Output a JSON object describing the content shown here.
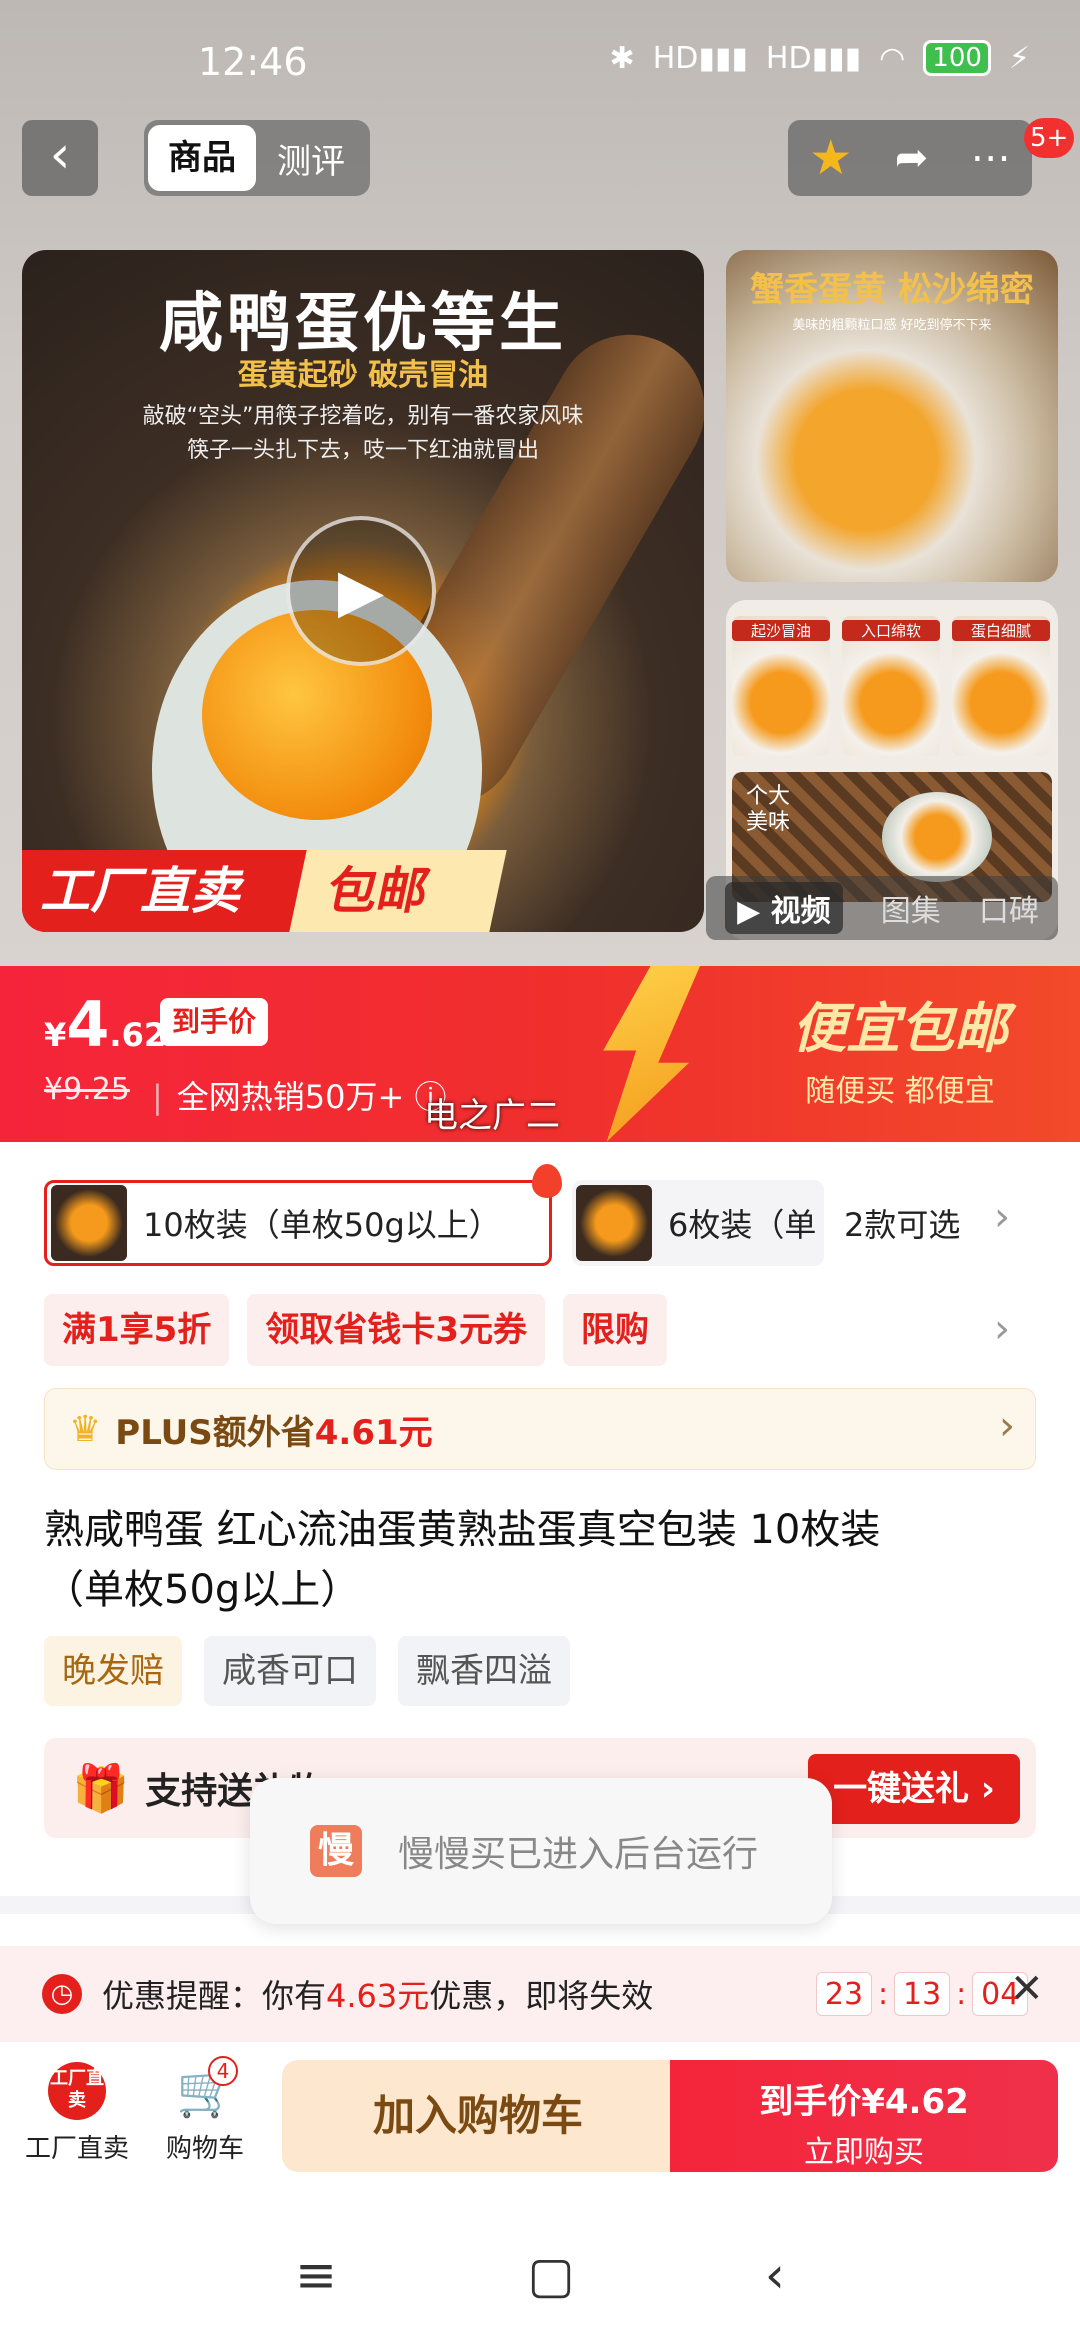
{
  "status_bar": {
    "time": "12:46",
    "network": "HD",
    "battery": "100"
  },
  "nav": {
    "back_icon": "back-icon",
    "tabs": [
      {
        "label": "商品",
        "active": true
      },
      {
        "label": "测评",
        "active": false
      }
    ],
    "message_badge": "5+"
  },
  "gallery": {
    "main": {
      "title": "咸鸭蛋优等生",
      "subtitle": "蛋黄起砂 破壳冒油",
      "desc_line1": "敲破“空头”用筷子挖着吃，别有一番农家风味",
      "desc_line2": "筷子一头扎下去，吱一下红油就冒出",
      "promo_left": "工厂直卖",
      "promo_right": "包邮"
    },
    "thumb1": {
      "caption": "蟹香蛋黄 松沙绵密",
      "caption_small": "美味的粗颗粒口感 好吃到停不下来"
    },
    "thumb2": {
      "labels": [
        "起沙冒油",
        "入口绵软",
        "蛋白细腻"
      ],
      "basket_label_1": "个大",
      "basket_label_2": "美味"
    },
    "media_tabs": [
      {
        "label": "视频",
        "active": true
      },
      {
        "label": "图集",
        "active": false
      },
      {
        "label": "口碑",
        "active": false
      }
    ]
  },
  "price": {
    "symbol": "¥",
    "integer": "4",
    "decimal": ".62",
    "tag": "到手价",
    "original": "¥9.25",
    "sales": "全网热销50万+",
    "campaign_title": "便宜包邮",
    "campaign_sub": "随便买 都便宜",
    "watermark": "电之广二"
  },
  "variants": {
    "items": [
      {
        "label": "10枚装（单枚50g以上）",
        "selected": true
      },
      {
        "label": "6枚装（单",
        "selected": false
      }
    ],
    "count": "2款可选"
  },
  "coupons": [
    "满1享5折",
    "领取省钱卡3元券",
    "限购"
  ],
  "plus": {
    "label": "PLUS额外省",
    "amount": "4.61元"
  },
  "product": {
    "title": "熟咸鸭蛋 红心流油蛋黄熟盐蛋真空包装 10枚装\n（单枚50g以上）",
    "tags": [
      "晚发赔",
      "咸香可口",
      "飘香四溢"
    ]
  },
  "gift": {
    "label": "支持送礼物",
    "button": "一键送礼 ›"
  },
  "toast": {
    "icon_text": "慢",
    "message": "慢慢买已进入后台运行"
  },
  "reminder": {
    "prefix": "优惠提醒：你有",
    "amount": "4.63元",
    "suffix": "优惠，即将失效",
    "hours": "23",
    "minutes": "13",
    "seconds": "04"
  },
  "bottom_bar": {
    "factory_label": "工厂直卖",
    "factory_icon_text": "工厂直卖",
    "cart_label": "购物车",
    "cart_badge": "4",
    "add_to_cart": "加入购物车",
    "buy_line1": "到手价¥4.62",
    "buy_line2": "立即购买"
  },
  "colors": {
    "brand_red": "#e3201b",
    "plus_brown": "#7a4a12",
    "plus_gold": "#f0b323"
  }
}
